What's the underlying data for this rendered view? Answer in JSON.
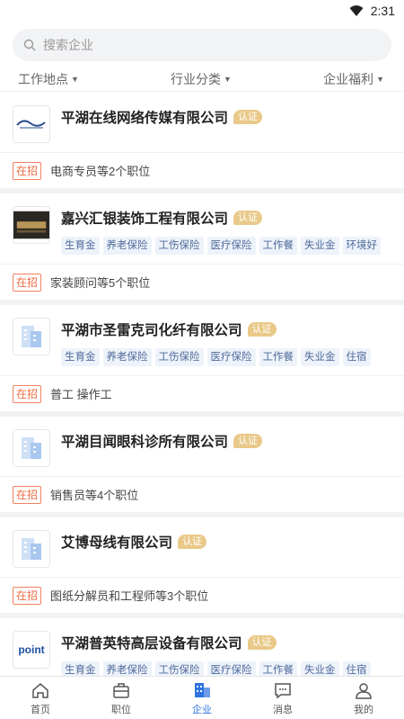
{
  "status": {
    "time": "2:31"
  },
  "search": {
    "placeholder": "搜索企业"
  },
  "filters": [
    {
      "label": "工作地点"
    },
    {
      "label": "行业分类"
    },
    {
      "label": "企业福利"
    }
  ],
  "cert_label": "认证",
  "hiring_label": "在招",
  "companies": [
    {
      "name": "平湖在线网络传媒有限公司",
      "logo": "custom-logo-1",
      "tags": [],
      "jobs": "电商专员等2个职位"
    },
    {
      "name": "嘉兴汇银装饰工程有限公司",
      "logo": "custom-logo-2",
      "tags": [
        "生育金",
        "养老保险",
        "工伤保险",
        "医疗保险",
        "工作餐",
        "失业金",
        "环境好"
      ],
      "jobs": "家装顾问等5个职位"
    },
    {
      "name": "平湖市圣雷克司化纤有限公司",
      "logo": "default-building-icon",
      "tags": [
        "生育金",
        "养老保险",
        "工伤保险",
        "医疗保险",
        "工作餐",
        "失业金",
        "住宿"
      ],
      "jobs": "普工  操作工"
    },
    {
      "name": "平湖目闻眼科诊所有限公司",
      "logo": "default-building-icon",
      "tags": [],
      "jobs": "销售员等4个职位"
    },
    {
      "name": "艾博母线有限公司",
      "logo": "default-building-icon",
      "tags": [],
      "jobs": "图纸分解员和工程师等3个职位"
    },
    {
      "name": "平湖普英特高层设备有限公司",
      "logo": "point-logo",
      "logo_text": "point",
      "tags": [
        "生育金",
        "养老保险",
        "工伤保险",
        "医疗保险",
        "工作餐",
        "失业金",
        "住宿"
      ],
      "jobs": ""
    }
  ],
  "tabbar": [
    {
      "label": "首页",
      "icon": "home-icon"
    },
    {
      "label": "职位",
      "icon": "briefcase-icon"
    },
    {
      "label": "企业",
      "icon": "building-icon",
      "active": true
    },
    {
      "label": "消息",
      "icon": "message-icon"
    },
    {
      "label": "我的",
      "icon": "user-icon"
    }
  ],
  "colors": {
    "accent": "#2f73e0",
    "cert": "#e9c989",
    "hiring": "#f06a40"
  }
}
